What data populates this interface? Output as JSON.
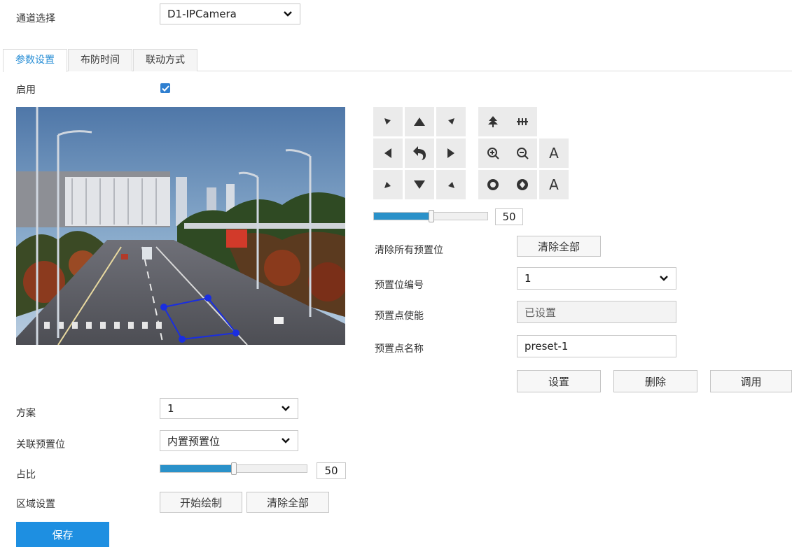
{
  "channel": {
    "label": "通道选择",
    "value": "D1-IPCamera"
  },
  "tabs": [
    {
      "label": "参数设置",
      "active": true
    },
    {
      "label": "布防时间",
      "active": false
    },
    {
      "label": "联动方式",
      "active": false
    }
  ],
  "enable": {
    "label": "启用",
    "checked": true
  },
  "video": {
    "description_icon": "camera-live-view"
  },
  "ptz": {
    "speed_value": "50",
    "speed_fraction": 0.5,
    "zoom_auto_label": "A",
    "focus_auto_label": "A"
  },
  "preset": {
    "clear_all_label": "清除所有预置位",
    "clear_all_button": "清除全部",
    "number_label": "预置位编号",
    "number_value": "1",
    "enable_label": "预置点使能",
    "enable_value": "已设置",
    "name_label": "预置点名称",
    "name_value": "preset-1",
    "set_button": "设置",
    "delete_button": "删除",
    "call_button": "调用"
  },
  "scheme": {
    "label": "方案",
    "value": "1"
  },
  "linked_preset": {
    "label": "关联预置位",
    "value": "内置预置位"
  },
  "ratio": {
    "label": "占比",
    "value": "50",
    "fraction": 0.5
  },
  "area": {
    "label": "区域设置",
    "start_button": "开始绘制",
    "clear_button": "清除全部"
  },
  "save_button": "保存",
  "colors": {
    "accent": "#1e8fe1",
    "slider": "#2a91c9",
    "tab_active": "#2a8fd6",
    "region_line": "#1a2ee0"
  }
}
